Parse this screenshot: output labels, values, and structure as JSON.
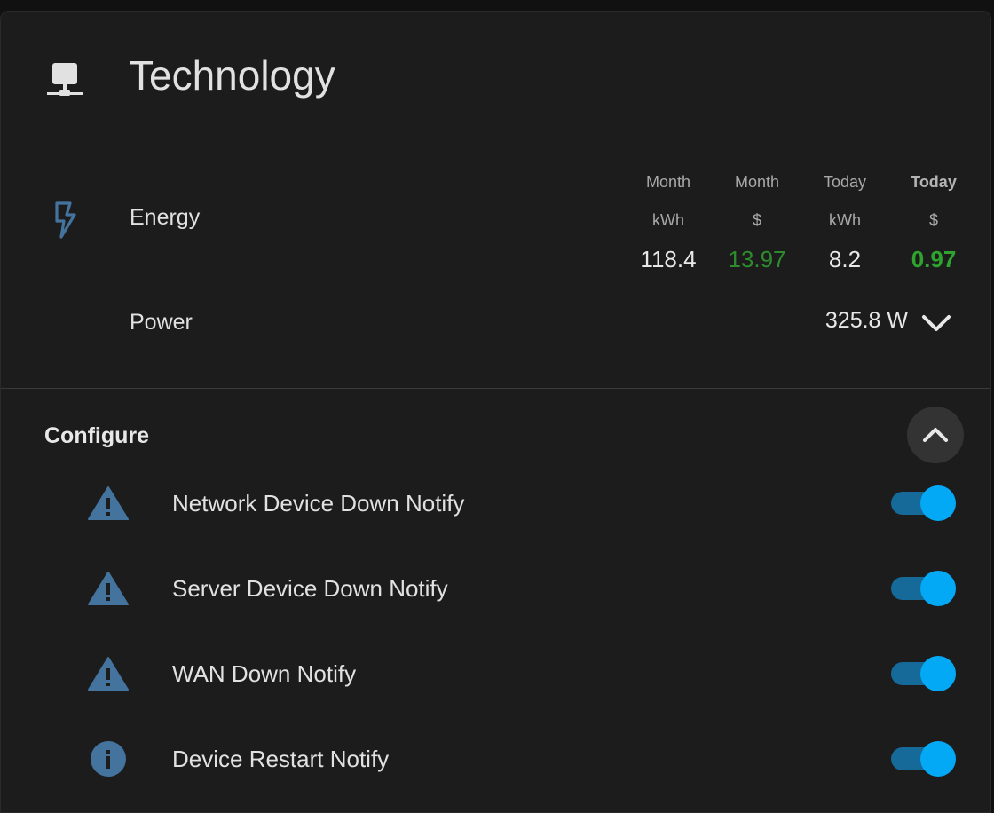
{
  "card": {
    "title": "Technology",
    "icon": "server-network-icon"
  },
  "energy": {
    "label": "Energy",
    "icon": "lightning-bolt-icon",
    "columns": [
      {
        "head1": "Month",
        "head2": "kWh",
        "value": "118.4"
      },
      {
        "head1": "Month",
        "head2": "$",
        "value": "13.97"
      },
      {
        "head1": "Today",
        "head2": "kWh",
        "value": "8.2"
      },
      {
        "head1": "Today",
        "head2": "$",
        "value": "0.97"
      }
    ],
    "cost_color": "#2e8b2e"
  },
  "power": {
    "label": "Power",
    "value": "325.8 W"
  },
  "configure": {
    "title": "Configure",
    "items": [
      {
        "label": "Network Device Down Notify",
        "icon": "alert-icon",
        "on": true
      },
      {
        "label": "Server Device Down Notify",
        "icon": "alert-icon",
        "on": true
      },
      {
        "label": "WAN Down Notify",
        "icon": "alert-icon",
        "on": true
      },
      {
        "label": "Device Restart Notify",
        "icon": "information-icon",
        "on": true
      }
    ]
  },
  "colors": {
    "accent": "#03a9f4",
    "icon": "#44739e",
    "background": "#1c1c1c"
  }
}
